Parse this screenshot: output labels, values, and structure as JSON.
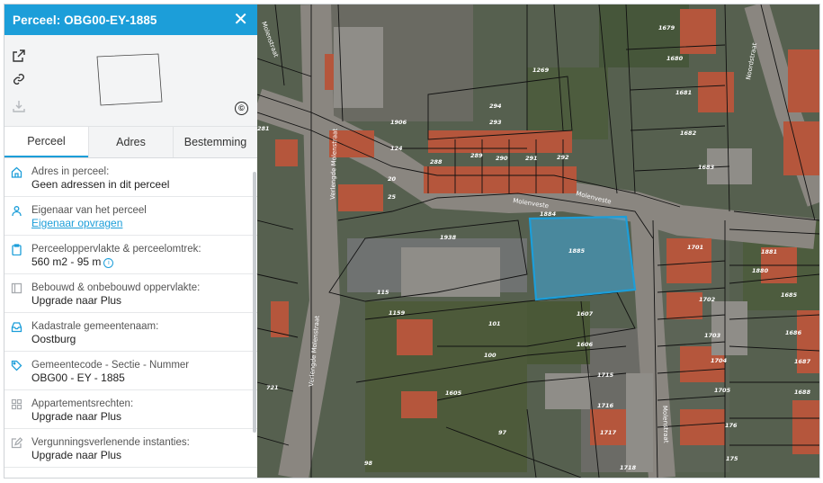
{
  "panel": {
    "title": "Perceel: OBG00-EY-1885",
    "tabs": [
      {
        "label": "Perceel",
        "active": true
      },
      {
        "label": "Adres",
        "active": false
      },
      {
        "label": "Bestemming",
        "active": false
      }
    ],
    "copyright_symbol": "©",
    "rows": [
      {
        "icon": "house-icon",
        "label": "Adres in perceel:",
        "value": "Geen adressen in dit perceel"
      },
      {
        "icon": "person-icon",
        "label": "Eigenaar van het perceel",
        "value": "Eigenaar opvragen"
      },
      {
        "icon": "clipboard-icon",
        "label": "Perceeloppervlakte & perceelomtrek:",
        "value": "560 m2 - 95 m"
      },
      {
        "icon": "layout-icon",
        "label": "Bebouwd & onbebouwd oppervlakte:",
        "value": "Upgrade naar Plus"
      },
      {
        "icon": "inbox-icon",
        "label": "Kadastrale gemeentenaam:",
        "value": "Oostburg"
      },
      {
        "icon": "tag-icon",
        "label": "Gemeentecode - Sectie - Nummer",
        "value": "OBG00 - EY - 1885"
      },
      {
        "icon": "grid-icon",
        "label": "Appartementsrechten:",
        "value": "Upgrade naar Plus"
      },
      {
        "icon": "edit-icon",
        "label": "Vergunningsverlenende instanties:",
        "value": "Upgrade naar Plus"
      }
    ]
  },
  "colors": {
    "accent": "#1c9ed9",
    "selection": "#3fa9de"
  },
  "map": {
    "streets": [
      "Molenveste",
      "Molenveste",
      "Molenstraat",
      "Verlengde Molenstraat",
      "Verlengde Molenstraat",
      "Noordstraat",
      "Molenstraat"
    ],
    "parcels": [
      "1679",
      "1680",
      "1681",
      "1682",
      "1683",
      "1269",
      "294",
      "293",
      "1906",
      "124",
      "20",
      "25",
      "288",
      "289",
      "290",
      "291",
      "292",
      "1884",
      "1885",
      "1938",
      "1701",
      "1881",
      "1880",
      "1685",
      "1702",
      "1686",
      "1703",
      "1687",
      "1704",
      "1688",
      "1705",
      "176",
      "175",
      "115",
      "1159",
      "101",
      "1607",
      "1606",
      "100",
      "1715",
      "1716",
      "1605",
      "1717",
      "97",
      "1718",
      "98",
      "721",
      "281"
    ]
  }
}
